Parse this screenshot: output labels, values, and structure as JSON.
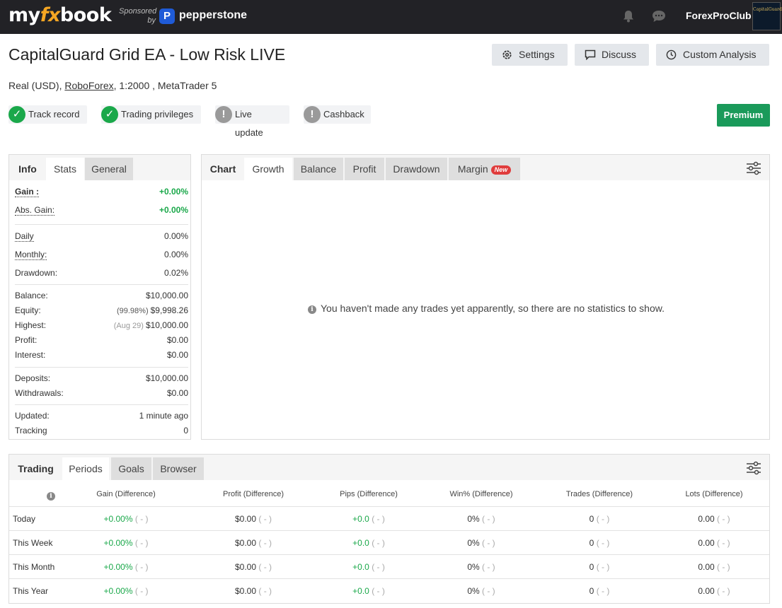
{
  "header": {
    "logo": {
      "my": "my",
      "fx": "fx",
      "book": "book"
    },
    "sponsored_line1": "Sponsored",
    "sponsored_line2": "by",
    "sponsor_badge": "P",
    "sponsor_name": "pepperstone",
    "user_name": "ForexProClub",
    "avatar_text1": "CapitalGuard",
    "icons": [
      "bell-icon",
      "chat-icon"
    ]
  },
  "page": {
    "title": "CapitalGuard Grid EA - Low Risk LIVE",
    "buttons": {
      "settings": "Settings",
      "discuss": "Discuss",
      "custom_analysis": "Custom Analysis"
    },
    "account_type": "Real (USD), ",
    "broker": "RoboForex",
    "account_rest": ", 1:2000 , MetaTrader 5",
    "badges": {
      "track_record": "Track record",
      "trading_privileges": "Trading privileges",
      "live_update": "Live update",
      "cashback": "Cashback"
    },
    "premium": "Premium"
  },
  "stats_panel": {
    "tabs": {
      "info": "Info",
      "stats": "Stats",
      "general": "General"
    },
    "gain_label": "Gain :",
    "gain_value": "+0.00%",
    "abs_gain_label": "Abs. Gain:",
    "abs_gain_value": "+0.00%",
    "daily_label": "Daily",
    "daily_value": "0.00%",
    "monthly_label": "Monthly:",
    "monthly_value": "0.00%",
    "drawdown_label": "Drawdown:",
    "drawdown_value": "0.02%",
    "balance_label": "Balance:",
    "balance_value": "$10,000.00",
    "equity_label": "Equity:",
    "equity_pct": "(99.98%)",
    "equity_value": "$9,998.26",
    "highest_label": "Highest:",
    "highest_date": "(Aug 29)",
    "highest_value": "$10,000.00",
    "profit_label": "Profit:",
    "profit_value": "$0.00",
    "interest_label": "Interest:",
    "interest_value": "$0.00",
    "deposits_label": "Deposits:",
    "deposits_value": "$10,000.00",
    "withdrawals_label": "Withdrawals:",
    "withdrawals_value": "$0.00",
    "updated_label": "Updated:",
    "updated_value": "1 minute ago",
    "tracking_label": "Tracking",
    "tracking_value": "0"
  },
  "chart_panel": {
    "tabs": {
      "chart": "Chart",
      "growth": "Growth",
      "balance": "Balance",
      "profit": "Profit",
      "drawdown": "Drawdown",
      "margin": "Margin",
      "new_badge": "New"
    },
    "empty_message": "You haven't made any trades yet apparently, so there are no statistics to show."
  },
  "trading_panel": {
    "tabs": {
      "trading": "Trading",
      "periods": "Periods",
      "goals": "Goals",
      "browser": "Browser"
    },
    "columns": [
      "Gain (Difference)",
      "Profit (Difference)",
      "Pips (Difference)",
      "Win% (Difference)",
      "Trades (Difference)",
      "Lots (Difference)"
    ],
    "rows": [
      {
        "period": "Today",
        "gain": "+0.00%",
        "profit": "$0.00",
        "pips": "+0.0",
        "win": "0%",
        "trades": "0",
        "lots": "0.00",
        "diff": "( - )"
      },
      {
        "period": "This Week",
        "gain": "+0.00%",
        "profit": "$0.00",
        "pips": "+0.0",
        "win": "0%",
        "trades": "0",
        "lots": "0.00",
        "diff": "( - )"
      },
      {
        "period": "This Month",
        "gain": "+0.00%",
        "profit": "$0.00",
        "pips": "+0.0",
        "win": "0%",
        "trades": "0",
        "lots": "0.00",
        "diff": "( - )"
      },
      {
        "period": "This Year",
        "gain": "+0.00%",
        "profit": "$0.00",
        "pips": "+0.0",
        "win": "0%",
        "trades": "0",
        "lots": "0.00",
        "diff": "( - )"
      }
    ]
  },
  "colors": {
    "green": "#1aa84a",
    "premium": "#1a9a5a",
    "header": "#222226",
    "new_badge": "#e03c3c",
    "sponsor_blue": "#1f5bd7"
  }
}
